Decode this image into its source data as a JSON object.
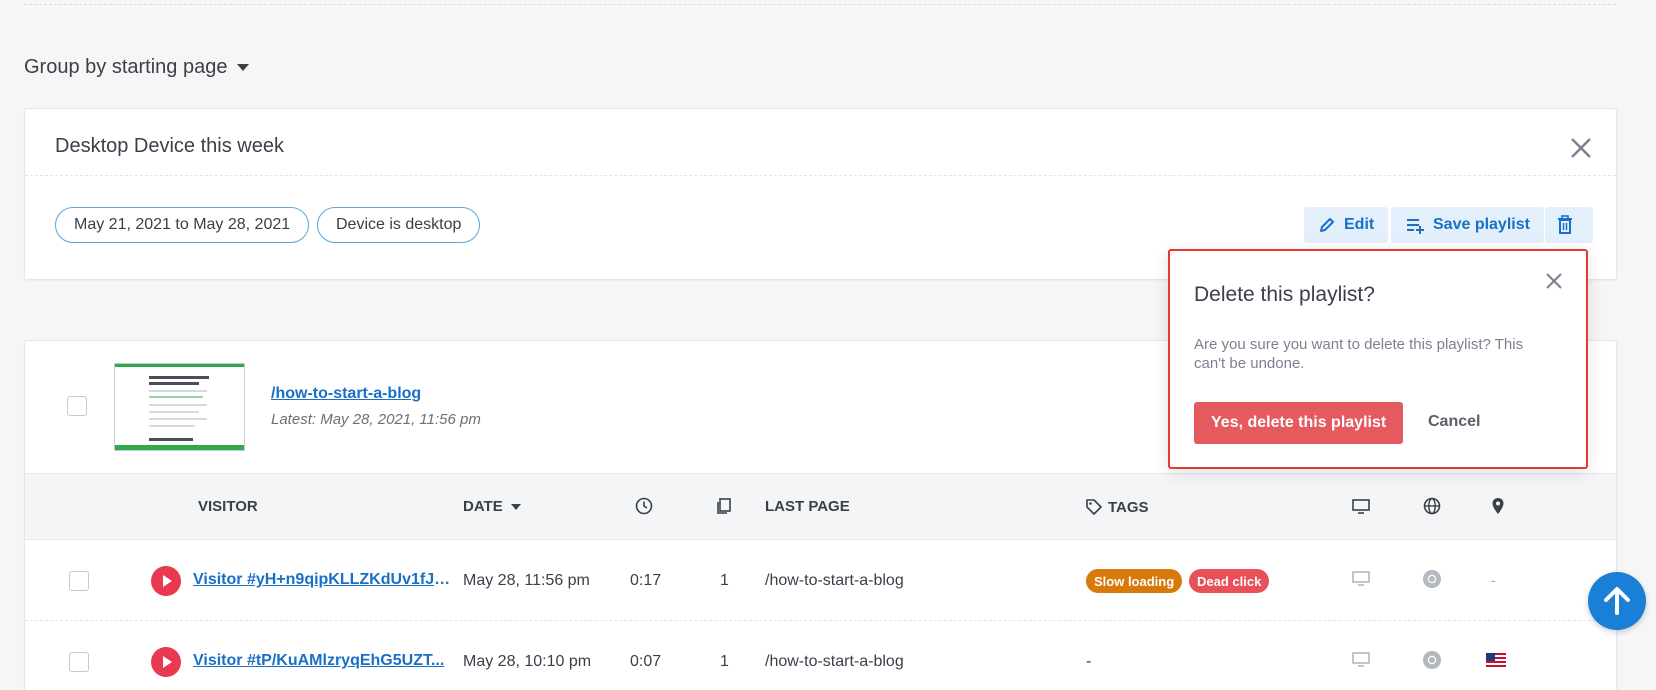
{
  "group_by": {
    "label": "Group by starting page"
  },
  "filter_card": {
    "title": "Desktop Device this week",
    "pills": [
      "May 21, 2021 to May 28, 2021",
      "Device is desktop"
    ],
    "edit_label": "Edit",
    "save_label": "Save playlist"
  },
  "page_group": {
    "path": "/how-to-start-a-blog",
    "latest": "Latest: May 28, 2021, 11:56 pm"
  },
  "table": {
    "headers": {
      "visitor": "VISITOR",
      "date": "DATE",
      "last_page": "LAST PAGE",
      "tags": "TAGS"
    },
    "rows": [
      {
        "visitor": "Visitor #yH+n9qipKLLZKdUv1fJE...",
        "date": "May 28, 11:56 pm",
        "duration": "0:17",
        "pages": "1",
        "last_page": "/how-to-start-a-blog",
        "tags": [
          "Slow loading",
          "Dead click"
        ],
        "location": "-"
      },
      {
        "visitor": "Visitor #tP/KuAMlzryqEhG5UZT...",
        "date": "May 28, 10:10 pm",
        "duration": "0:07",
        "pages": "1",
        "last_page": "/how-to-start-a-blog",
        "tags_text": "-",
        "location_flag": "us-flag-icon"
      }
    ]
  },
  "delete_popover": {
    "title": "Delete this playlist?",
    "message": "Are you sure you want to delete this playlist? This can't be undone.",
    "confirm_label": "Yes, delete this playlist",
    "cancel_label": "Cancel"
  },
  "colors": {
    "accent": "#1a6fc7",
    "danger": "#e45a5f",
    "tag_slow": "#d7790b",
    "tag_dead": "#e8515a",
    "highlight": "#e53935"
  }
}
